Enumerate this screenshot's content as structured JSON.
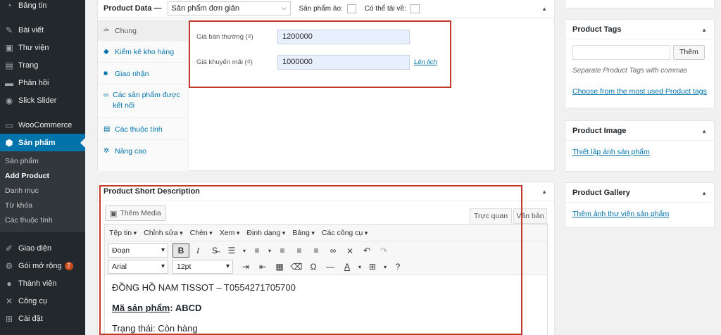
{
  "sidebar": {
    "items_top": [
      {
        "label": "Bảng tin",
        "icon": "dashboard-icon"
      },
      {
        "label": "Bài viết",
        "icon": "pin-icon"
      },
      {
        "label": "Thư viện",
        "icon": "media-icon"
      },
      {
        "label": "Trang",
        "icon": "page-icon"
      },
      {
        "label": "Phản hồi",
        "icon": "comment-icon"
      },
      {
        "label": "Slick Slider",
        "icon": "slider-icon"
      }
    ],
    "woocommerce": "WooCommerce",
    "products": "Sản phẩm",
    "submenu": [
      "Sản phẩm",
      "Add Product",
      "Danh mục",
      "Từ khóa",
      "Các thuộc tính"
    ],
    "submenu_current_index": 1,
    "items_bottom": [
      {
        "label": "Giao diện",
        "icon": "appearance-icon"
      },
      {
        "label": "Gói mở rộng",
        "icon": "plugin-icon",
        "badge": "2"
      },
      {
        "label": "Thành viên",
        "icon": "users-icon"
      },
      {
        "label": "Công cụ",
        "icon": "tools-icon"
      },
      {
        "label": "Cài đặt",
        "icon": "settings-icon"
      }
    ],
    "accent": "#0073aa"
  },
  "product_data": {
    "title": "Product Data —",
    "type_select": "Sản phẩm đơn giản",
    "virtual_label": "Sản phẩm ảo:",
    "downloadable_label": "Có thể tải về:",
    "tabs": [
      {
        "label": "Chung",
        "icon": "wrench-icon"
      },
      {
        "label": "Kiểm kê kho hàng",
        "icon": "inventory-icon"
      },
      {
        "label": "Giao nhận",
        "icon": "truck-icon"
      },
      {
        "label": "Các sản phẩm được kết nối",
        "icon": "link-icon"
      },
      {
        "label": "Các thuộc tính",
        "icon": "list-icon"
      },
      {
        "label": "Nâng cao",
        "icon": "gear-icon"
      }
    ],
    "regular_price_label": "Giá bán thường (₫)",
    "regular_price": "1200000",
    "sale_price_label": "Giá khuyến mãi (₫)",
    "sale_price": "1000000",
    "schedule_link": "Lên lịch"
  },
  "short_description": {
    "title": "Product Short Description",
    "add_media": "Thêm Media",
    "tab_visual": "Trực quan",
    "tab_text": "Văn bản",
    "menubar": [
      "Tệp tin",
      "Chỉnh sửa",
      "Chèn",
      "Xem",
      "Định dạng",
      "Bảng",
      "Các công cụ"
    ],
    "format_select": "Đoạn",
    "font_select": "Arial",
    "size_select": "12pt",
    "content_line1": "ĐỒNG HỒ NAM TISSOT – T0554271705700",
    "content_label2": "Mã sản phẩm",
    "content_value2": "ABCD",
    "content_line3": "Trạng thái: Còn hàng"
  },
  "tags": {
    "title": "Product Tags",
    "add_button": "Thêm",
    "hint": "Separate Product Tags with commas",
    "choose_link": "Choose from the most used Product tags"
  },
  "image": {
    "title": "Product Image",
    "set_link": "Thiết lập ảnh sản phẩm"
  },
  "gallery": {
    "title": "Product Gallery",
    "add_link": "Thêm ảnh thư viện sản phẩm"
  },
  "highlight_color": "#c0392b"
}
